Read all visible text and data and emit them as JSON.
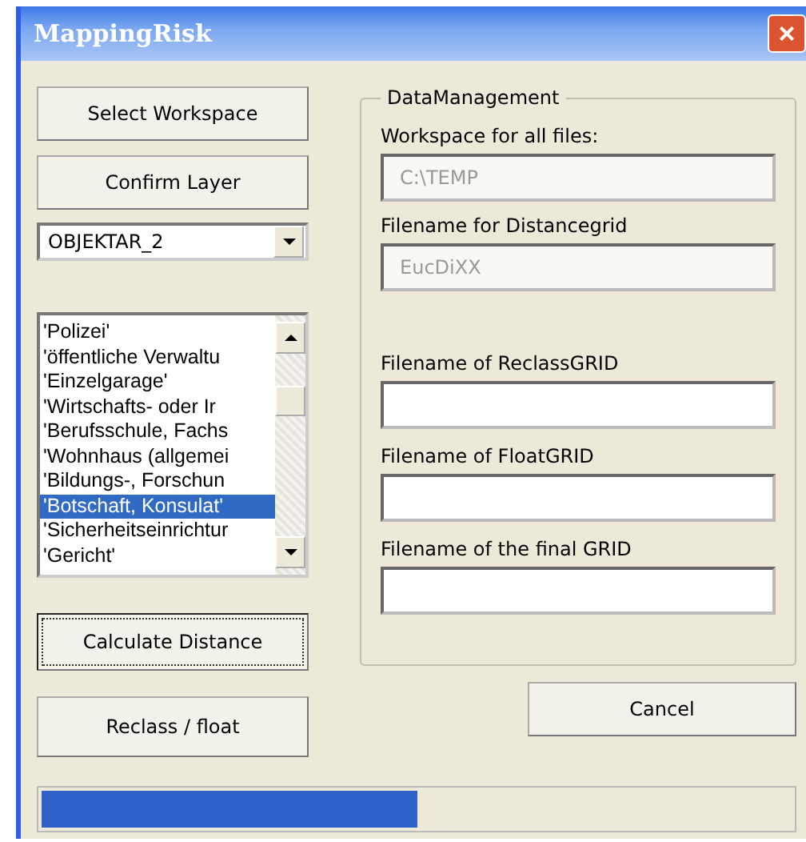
{
  "window": {
    "title": "MappingRisk",
    "close": "×"
  },
  "left_buttons": [
    {
      "label": "Select Workspace",
      "focused": false
    },
    {
      "label": "Confirm Layer",
      "focused": false
    }
  ],
  "layer_combo": {
    "value": "OBJEKTAR_2"
  },
  "list": {
    "items": [
      {
        "label": "'Polizei'",
        "selected": false
      },
      {
        "label": "'öffentliche Verwaltu",
        "selected": false
      },
      {
        "label": "'Einzelgarage'",
        "selected": false
      },
      {
        "label": "'Wirtschafts- oder Ir",
        "selected": false
      },
      {
        "label": "'Berufsschule, Fachs",
        "selected": false
      },
      {
        "label": "'Wohnhaus (allgemei",
        "selected": false
      },
      {
        "label": "'Bildungs-, Forschun",
        "selected": false
      },
      {
        "label": "'Botschaft, Konsulat'",
        "selected": true
      },
      {
        "label": "'Sicherheitseinrichtur",
        "selected": false
      },
      {
        "label": "'Gericht'",
        "selected": false
      }
    ]
  },
  "action_buttons": [
    {
      "label": "Calculate Distance",
      "focused": true
    },
    {
      "label": "Reclass / float",
      "focused": false
    }
  ],
  "group": {
    "title": "DataManagement",
    "fields": [
      {
        "label": "Workspace for all files:",
        "value": "C:\\TEMP",
        "disabled": true
      },
      {
        "label": "Filename for Distancegrid",
        "value": "EucDiXX",
        "disabled": true
      },
      {
        "label": "Filename of ReclassGRID"
      },
      {
        "label": "Filename of FloatGRID"
      },
      {
        "label": "Filename of the final GRID"
      }
    ]
  },
  "cancel_button": {
    "label": "Cancel"
  },
  "progress": {
    "level": 0.5
  }
}
